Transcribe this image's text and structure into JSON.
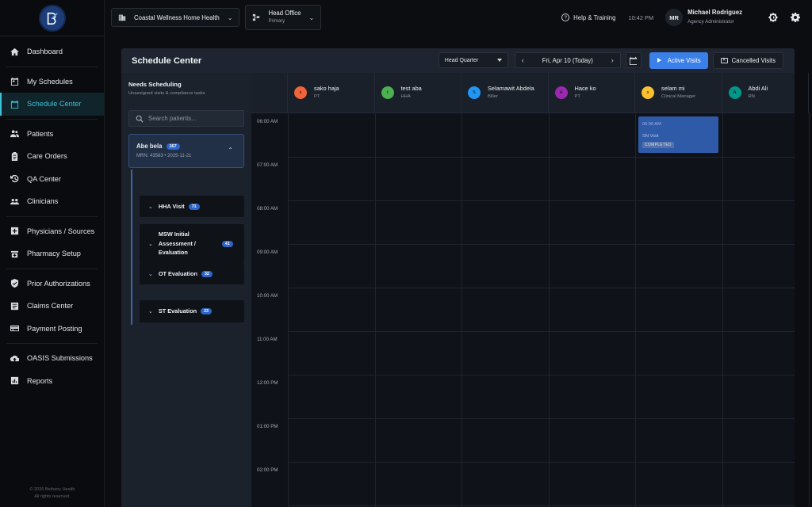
{
  "sidebar": {
    "items": [
      {
        "label": "Dashboard",
        "icon": "home-icon"
      },
      {
        "label": "My Schedules",
        "icon": "calendar-check-icon"
      },
      {
        "label": "Schedule Center",
        "icon": "calendar-icon",
        "active": true
      },
      {
        "label": "Patients",
        "icon": "people-icon"
      },
      {
        "label": "Care Orders",
        "icon": "clipboard-icon"
      },
      {
        "label": "QA Center",
        "icon": "history-icon"
      },
      {
        "label": "Clinicians",
        "icon": "group-icon"
      },
      {
        "label": "Physicians / Sources",
        "icon": "plus-box-icon"
      },
      {
        "label": "Pharmacy Setup",
        "icon": "pharmacy-icon"
      },
      {
        "label": "Prior Authorizations",
        "icon": "shield-check-icon"
      },
      {
        "label": "Claims Center",
        "icon": "list-icon"
      },
      {
        "label": "Payment Posting",
        "icon": "credit-card-icon"
      },
      {
        "label": "OASIS Submissions",
        "icon": "cloud-upload-icon"
      },
      {
        "label": "Reports",
        "icon": "chart-icon"
      }
    ],
    "copyright_line1": "© 2026 Bethany Health",
    "copyright_line2": "All rights reserved."
  },
  "topbar": {
    "agency": "Coastal Wellness Home Health",
    "office": "Head Office",
    "office_sub": "Primary",
    "help": "Help & Training",
    "time": "10:42 PM",
    "user_initials": "MR",
    "user_name": "Michael Rodriguez",
    "user_role": "Agency Administrator"
  },
  "schedule": {
    "title": "Schedule Center",
    "location": "Head Quarter",
    "date": "Fri, Apr 10 (Today)",
    "active_visits": "Active Visits",
    "cancelled_visits": "Cancelled Visits"
  },
  "needs": {
    "title": "Needs Scheduling",
    "subtitle": "Unassigned visits & compliance tasks",
    "search_placeholder": "Search patients...",
    "patient": {
      "name": "Abe bela",
      "count": "167",
      "meta": "MRN: 43583  • 2025-11-21"
    },
    "visits": [
      {
        "label": "HHA Visit",
        "count": "71"
      },
      {
        "label": "MSW Initial Assessment / Evaluation",
        "count": "41"
      },
      {
        "label": "OT Evaluation",
        "count": "32"
      },
      {
        "label": "ST Evaluation",
        "count": "23"
      }
    ]
  },
  "clinicians": [
    {
      "initial": "s",
      "name": "sako haja",
      "role": "PT",
      "color": "#f0643a"
    },
    {
      "initial": "t",
      "name": "test aba",
      "role": "HHA",
      "color": "#4caf50"
    },
    {
      "initial": "S",
      "name": "Selamawit Abdela",
      "role": "Biller",
      "color": "#2196f3"
    },
    {
      "initial": "H",
      "name": "Hace ko",
      "role": "PT",
      "color": "#9c27b0"
    },
    {
      "initial": "s",
      "name": "selam mi",
      "role": "Clinical Manager",
      "color": "#fbc02d"
    },
    {
      "initial": "A",
      "name": "Abdi Ali",
      "role": "RN",
      "color": "#009688"
    }
  ],
  "times": [
    "06:00 AM",
    "07:00 AM",
    "08:00 AM",
    "09:00 AM",
    "10:00 AM",
    "11:00 AM",
    "12:00 PM",
    "01:00 PM",
    "02:00 PM"
  ],
  "event": {
    "time": "06:00 AM",
    "name": "SN Visit",
    "status": "COMPLETED"
  }
}
